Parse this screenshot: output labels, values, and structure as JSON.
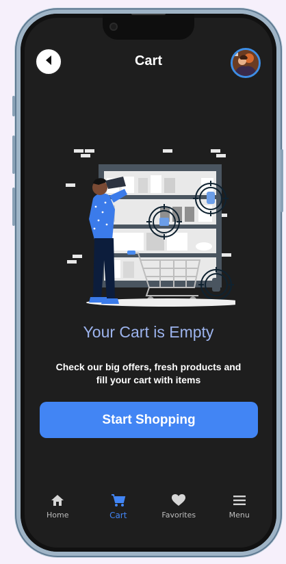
{
  "header": {
    "title": "Cart",
    "back_icon": "back-arrow-icon",
    "avatar_icon": "user-avatar"
  },
  "empty_state": {
    "title": "Your Cart is Empty",
    "description": "Check our big offers, fresh products and fill your cart with items",
    "illustration": "shopper-with-binoculars-empty-cart-illustration"
  },
  "cta": {
    "label": "Start Shopping"
  },
  "bottom_nav": {
    "items": [
      {
        "label": "Home",
        "icon": "home-icon",
        "active": false
      },
      {
        "label": "Cart",
        "icon": "cart-icon",
        "active": true
      },
      {
        "label": "Favorites",
        "icon": "heart-icon",
        "active": false
      },
      {
        "label": "Menu",
        "icon": "menu-icon",
        "active": false
      }
    ]
  },
  "colors": {
    "background": "#1e1e1e",
    "accent": "#4285f4",
    "empty_title": "#9db4ee",
    "nav_inactive": "#bdbdbd"
  }
}
